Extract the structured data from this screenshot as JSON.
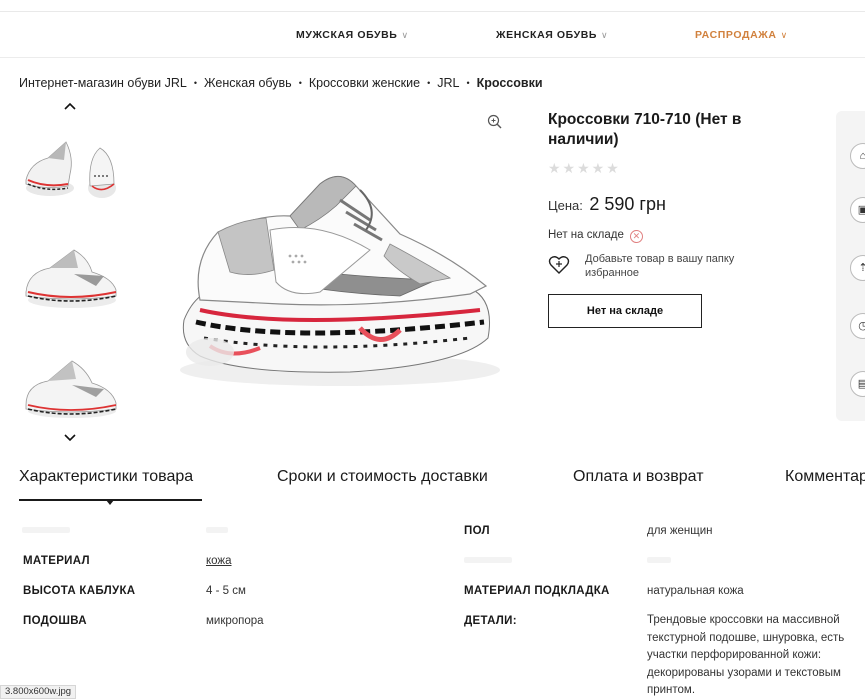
{
  "nav": {
    "items": [
      {
        "label": "МУЖСКАЯ ОБУВЬ",
        "chev": "∨"
      },
      {
        "label": "ЖЕНСКАЯ ОБУВЬ",
        "chev": "∨"
      },
      {
        "label": "РАСПРОДАЖА",
        "chev": "∨"
      }
    ],
    "sale_color": "#d1813d"
  },
  "breadcrumb": {
    "items": [
      "Интернет-магазин обуви JRL",
      "Женская обувь",
      "Кроссовки женские",
      "JRL"
    ],
    "current": "Кроссовки",
    "separator": "•"
  },
  "gallery": {
    "up_icon": "chevron-up-icon",
    "down_icon": "chevron-down-icon",
    "zoom_icon": "zoom-in-icon"
  },
  "product": {
    "title": "Кроссовки 710-710 (Нет в наличии)",
    "rating_stars": "★★★★★",
    "rating_value": 0,
    "price_label": "Цена:",
    "price_value": "2 590 грн",
    "stock_text": "Нет на складе",
    "wishlist_text": "Добавьте товар в вашу папку избранное",
    "button_label": "Нет на складе"
  },
  "tabs": [
    "Характеристики товара",
    "Сроки и стоимость доставки",
    "Оплата и возврат",
    "Комментар"
  ],
  "specs_left": [
    {
      "label": "МАТЕРИАЛ",
      "value": "кожа"
    },
    {
      "label": "ВЫСОТА КАБЛУКА",
      "value": "4 - 5 см"
    },
    {
      "label": "ПОДОШВА",
      "value": "микропора"
    }
  ],
  "specs_right": [
    {
      "label": "ПОЛ",
      "value": "для женщин"
    },
    {
      "label": "МАТЕРИАЛ ПОДКЛАДКА",
      "value": "натуральная кожа"
    },
    {
      "label": "ДЕТАЛИ:",
      "value": "Трендовые кроссовки на массивной текстурной подошве, шнуровка, есть участки перфорированной кожи: декорированы узорами и текстовым принтом."
    }
  ],
  "file_chip": "3.800x600w.jpg"
}
